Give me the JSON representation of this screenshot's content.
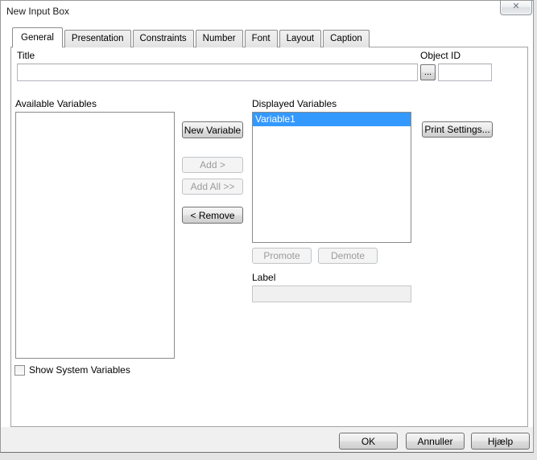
{
  "window": {
    "title": "New Input Box",
    "close_icon": "✕"
  },
  "tabs": [
    {
      "label": "General",
      "active": true
    },
    {
      "label": "Presentation",
      "active": false
    },
    {
      "label": "Constraints",
      "active": false
    },
    {
      "label": "Number",
      "active": false
    },
    {
      "label": "Font",
      "active": false
    },
    {
      "label": "Layout",
      "active": false
    },
    {
      "label": "Caption",
      "active": false
    }
  ],
  "general_tab": {
    "title_field": {
      "label": "Title",
      "value": ""
    },
    "object_id_field": {
      "label": "Object ID",
      "value": "",
      "browse_button": "..."
    },
    "available_variables": {
      "label": "Available Variables",
      "items": []
    },
    "displayed_variables": {
      "label": "Displayed Variables",
      "items": [
        "Variable1"
      ],
      "selected_index": 0
    },
    "buttons": {
      "new_variable": "New Variable",
      "add": "Add >",
      "add_all": "Add All >>",
      "remove": "< Remove",
      "print_settings": "Print Settings...",
      "promote": "Promote",
      "demote": "Demote"
    },
    "label_field": {
      "label": "Label",
      "value": "",
      "disabled": true
    },
    "show_system_variables": {
      "label": "Show System Variables",
      "checked": false
    }
  },
  "footer": {
    "ok": "OK",
    "cancel": "Annuller",
    "help": "Hjælp"
  },
  "colors": {
    "selection_blue": "#3399ff",
    "dialog_bg": "#ffffff",
    "footer_bg": "#f0f0f0"
  }
}
